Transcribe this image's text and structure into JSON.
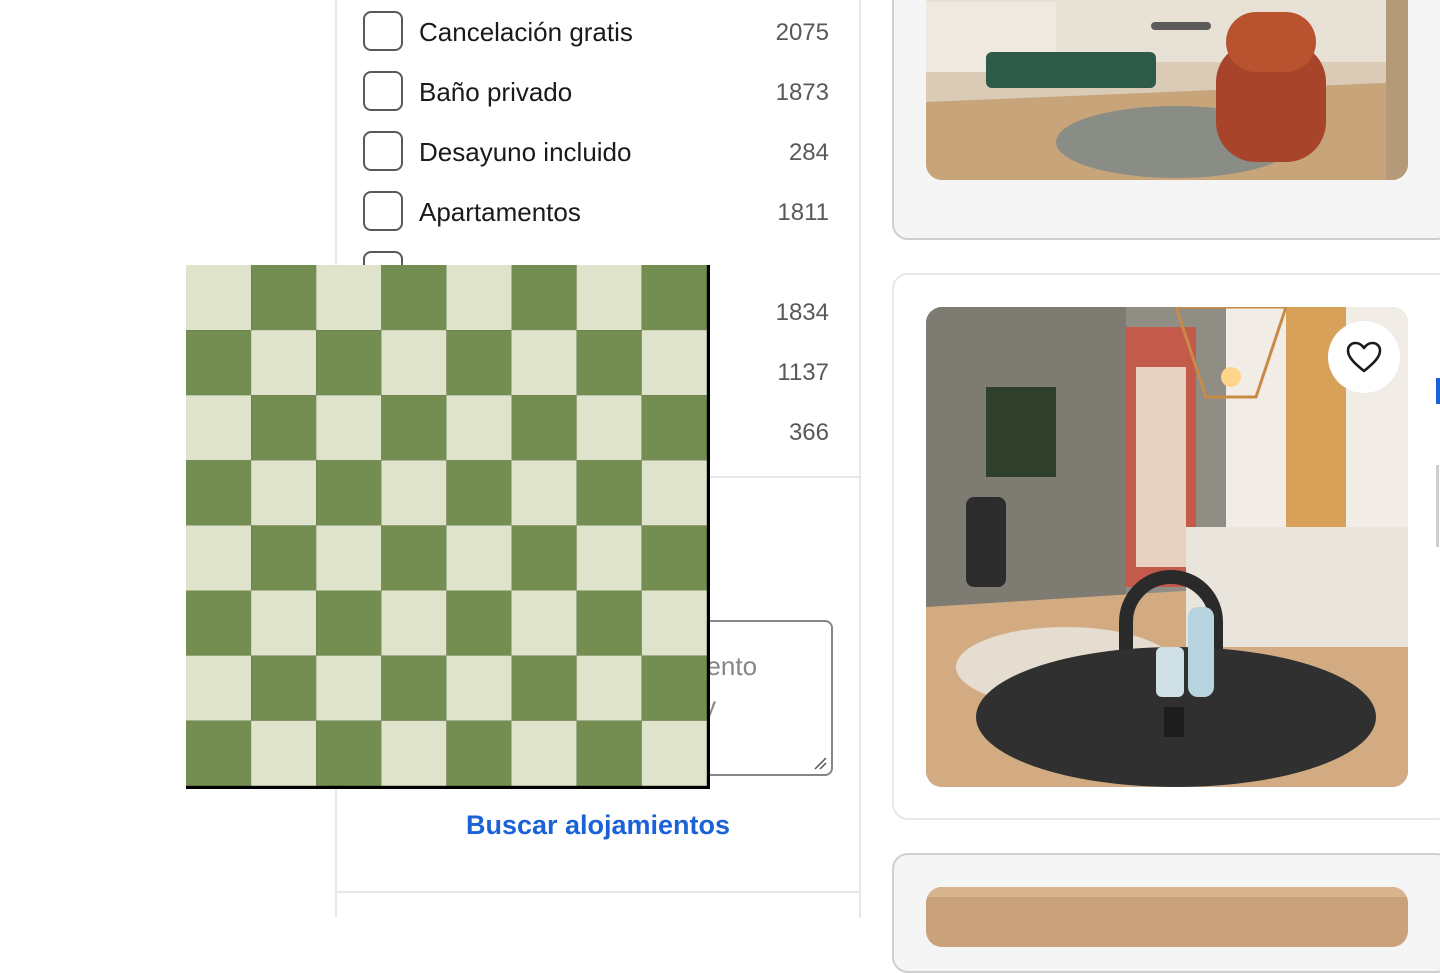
{
  "filters": {
    "items": [
      {
        "label": "Cancelación gratis",
        "count": "2075"
      },
      {
        "label": "Baño privado",
        "count": "1873"
      },
      {
        "label": "Desayuno incluido",
        "count": "284"
      },
      {
        "label": "Apartamentos",
        "count": "1811"
      },
      {
        "label": "",
        "count": ""
      },
      {
        "label": "",
        "count": "1834"
      },
      {
        "label": "",
        "count": "1137"
      },
      {
        "label": "",
        "count": "366"
      }
    ],
    "textarea_visible_text": [
      "miento",
      "y"
    ],
    "search_link": "Buscar alojamientos"
  },
  "chessboard": {
    "rows": 8,
    "cols": 8,
    "light_color": "#e0e3cb",
    "dark_color": "#748e52"
  },
  "listings": {
    "favorite_icon": "heart-outline-icon"
  },
  "colors": {
    "link_blue": "#1a62d6",
    "border": "#e7e7e7"
  }
}
